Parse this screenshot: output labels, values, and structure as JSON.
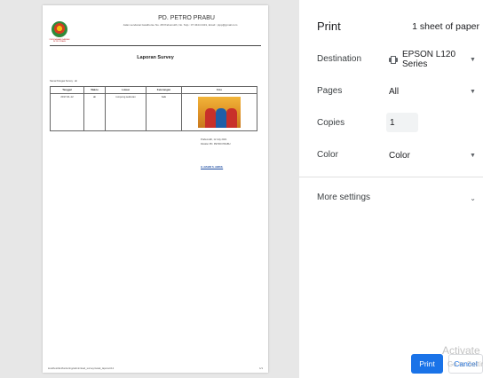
{
  "preview": {
    "logo_caption": "PERUSAHAAN DAERAH PETRO PRABU",
    "company_name": "PD. PETRO PRABU",
    "address": "Jalan sendanai Gwalhorse No. 28 Prabumulih, No. Telp.: 07 3444 2431, Email : ptpp@gmail.com",
    "report_title": "Laporan Survey",
    "surveyor_label": "Nama Petugas Survey : ab",
    "table": {
      "headers": [
        "Tanggal",
        "Waktu",
        "Lokasi",
        "Keterangan",
        "Foto"
      ],
      "row": [
        "2017-01-12",
        "ab",
        "rumpong sektoran",
        "baik"
      ]
    },
    "sign_date": "Prabumulih, 12 July 2021",
    "sign_role": "Direktur PD. PETRO PRABU",
    "sign_name": "H. AZHAR S. ABDUL",
    "footer_url": "localhost/E-Monitoring/admin/load_survey/cetak_laporan/12",
    "footer_page": "1/1"
  },
  "panel": {
    "title": "Print",
    "sheet_count": "1 sheet of paper",
    "destination_label": "Destination",
    "destination_value": "EPSON L120 Series",
    "pages_label": "Pages",
    "pages_value": "All",
    "copies_label": "Copies",
    "copies_value": "1",
    "color_label": "Color",
    "color_value": "Color",
    "more_settings": "More settings",
    "print_button": "Print",
    "cancel_button": "Cancel"
  },
  "watermark": {
    "line1": "Activate W",
    "line2": "Go to Settings"
  },
  "colors": {
    "accent": "#1a73e8",
    "preview_bg": "#e7e7e7"
  },
  "icons": [
    "printer-icon",
    "chevron-down-icon",
    "logo-emblem"
  ]
}
